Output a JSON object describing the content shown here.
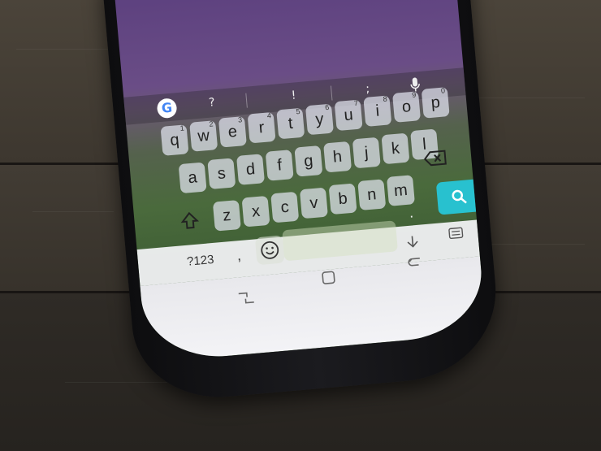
{
  "keyboard": {
    "suggestions": [
      "?",
      "!",
      ";"
    ],
    "row1": [
      {
        "label": "q",
        "num": "1"
      },
      {
        "label": "w",
        "num": "2"
      },
      {
        "label": "e",
        "num": "3"
      },
      {
        "label": "r",
        "num": "4"
      },
      {
        "label": "t",
        "num": "5"
      },
      {
        "label": "y",
        "num": "6"
      },
      {
        "label": "u",
        "num": "7"
      },
      {
        "label": "i",
        "num": "8"
      },
      {
        "label": "o",
        "num": "9"
      },
      {
        "label": "p",
        "num": "0"
      }
    ],
    "row2": [
      "a",
      "s",
      "d",
      "f",
      "g",
      "h",
      "j",
      "k",
      "l"
    ],
    "row3": [
      "z",
      "x",
      "c",
      "v",
      "b",
      "n",
      "m"
    ],
    "symbols_key": "?123",
    "comma_key": ",",
    "period_key": ".",
    "google_logo": "G"
  },
  "icons": {
    "mic": "mic-icon",
    "shift": "shift-icon",
    "backspace": "backspace-icon",
    "search": "search-icon",
    "emoji": "emoji-icon",
    "recent_apps": "recent-apps-icon",
    "home": "home-icon",
    "back": "back-icon",
    "keyboard_hide": "keyboard-hide-icon",
    "keyboard_switch": "keyboard-switch-icon"
  },
  "colors": {
    "search_accent": "#28c1cf",
    "key_background": "#e2e4f0"
  }
}
